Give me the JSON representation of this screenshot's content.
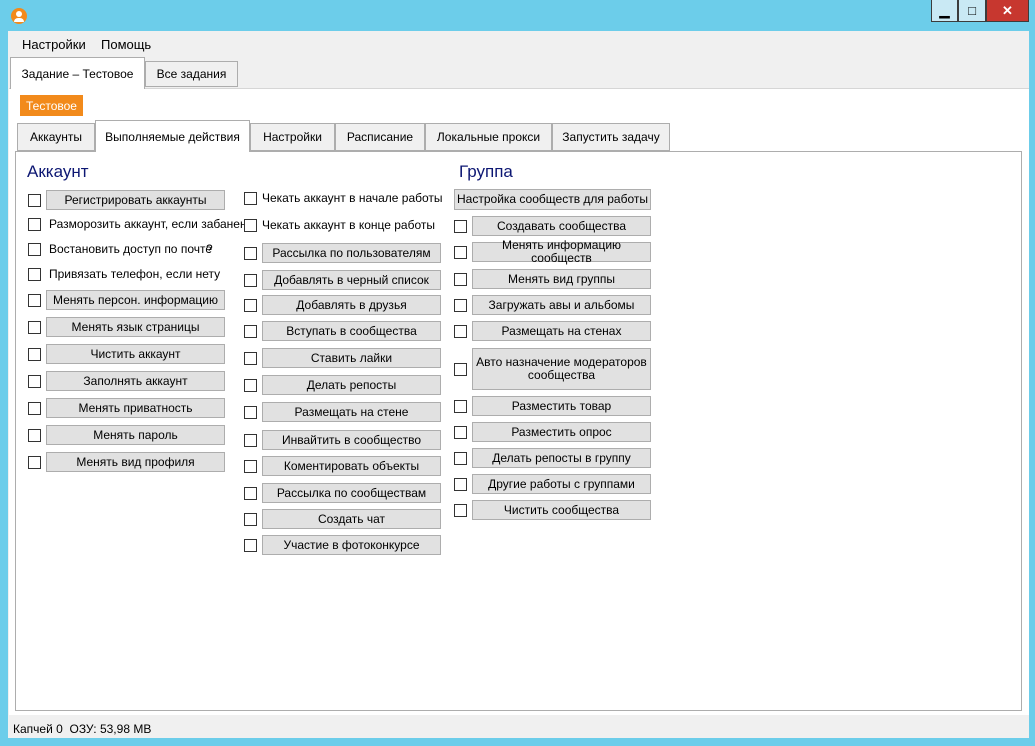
{
  "menu": {
    "settings": "Настройки",
    "help": "Помощь"
  },
  "outer_tabs": [
    "Задание – Тестовое",
    "Все задания"
  ],
  "task_badge": "Тестовое",
  "inner_tabs": [
    "Аккаунты",
    "Выполняемые действия",
    "Настройки",
    "Расписание",
    "Локальные прокси",
    "Запустить задачу"
  ],
  "account": {
    "title": "Аккаунт",
    "items": [
      "Регистрировать аккаунты",
      "Разморозить аккаунт, если забанен",
      "Востановить доступ по почте",
      "Привязать телефон, если нету",
      "Менять персон. информацию",
      "Менять язык страницы",
      "Чистить аккаунт",
      "Заполнять аккаунт",
      "Менять приватность",
      "Менять пароль",
      "Менять вид профиля"
    ],
    "help_mark": "?"
  },
  "actions": {
    "items": [
      "Чекать аккаунт в начале работы",
      "Чекать аккаунт в конце работы",
      "Рассылка по пользователям",
      "Добавлять в черный список",
      "Добавлять в друзья",
      "Вступать в сообщества",
      "Ставить лайки",
      "Делать репосты",
      "Размещать на стене",
      "Инвайтить в сообщество",
      "Коментировать объекты",
      "Рассылка по сообществам",
      "Создать чат",
      "Участие в фотоконкурсе"
    ]
  },
  "group": {
    "title": "Группа",
    "setup_button": "Настройка сообществ для работы",
    "items": [
      "Создавать сообщества",
      "Менять информацию сообществ",
      "Менять вид группы",
      "Загружать авы и альбомы",
      "Размещать на стенах",
      "Авто назначение модераторов сообщества",
      "Разместить товар",
      "Разместить опрос",
      "Делать репосты в группу",
      "Другие работы с группами",
      "Чистить сообщества"
    ]
  },
  "status": {
    "captcha": "Капчей 0",
    "ram": "ОЗУ: 53,98 MB"
  },
  "colors": {
    "frame": "#6ccdea",
    "accent": "#f28a1b",
    "section_title": "#0d1773",
    "close": "#c7372f"
  }
}
